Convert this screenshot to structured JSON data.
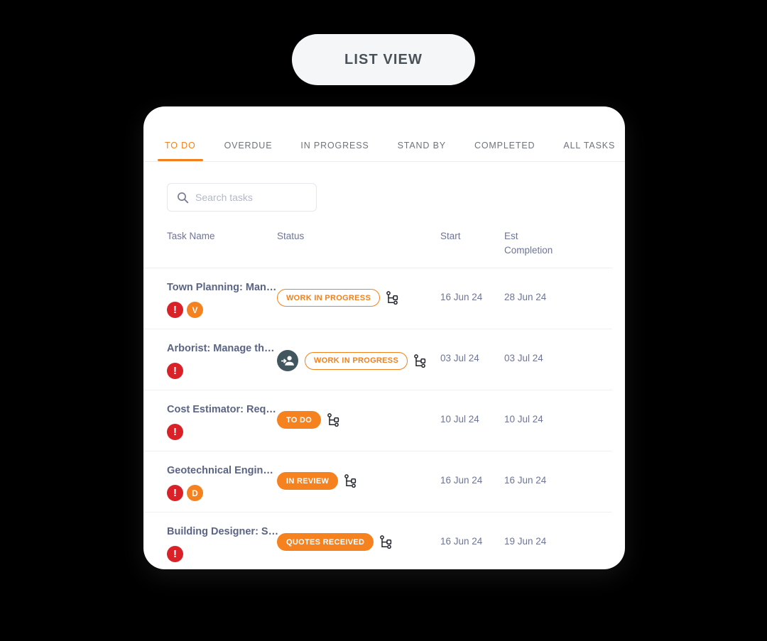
{
  "view_button": {
    "label": "LIST VIEW"
  },
  "tabs": [
    {
      "label": "TO DO",
      "active": true
    },
    {
      "label": "OVERDUE",
      "active": false
    },
    {
      "label": "IN PROGRESS",
      "active": false
    },
    {
      "label": "STAND BY",
      "active": false
    },
    {
      "label": "COMPLETED",
      "active": false
    },
    {
      "label": "ALL TASKS",
      "active": false
    }
  ],
  "search": {
    "value": "",
    "placeholder": "Search tasks",
    "icon": "search-icon"
  },
  "table": {
    "headers": {
      "task_name": "Task Name",
      "status": "Status",
      "start": "Start",
      "est_completion": "Est Completion"
    },
    "rows": [
      {
        "task_name": "Town Planning: Man…",
        "badges": [
          {
            "type": "alert",
            "label": "!",
            "color": "#da2128"
          },
          {
            "type": "letter",
            "label": "V",
            "color": "#f5821f"
          }
        ],
        "avatar": false,
        "status": {
          "label": "WORK IN PROGRESS",
          "style": "outline"
        },
        "branch_icon": "workflow-branch-icon",
        "start": "16 Jun 24",
        "est_completion": "28 Jun 24"
      },
      {
        "task_name": "Arborist: Manage th…",
        "badges": [
          {
            "type": "alert",
            "label": "!",
            "color": "#da2128"
          }
        ],
        "avatar": true,
        "status": {
          "label": "WORK IN PROGRESS",
          "style": "outline"
        },
        "branch_icon": "workflow-branch-icon",
        "start": "03 Jul 24",
        "est_completion": "03 Jul 24"
      },
      {
        "task_name": "Cost Estimator: Req…",
        "badges": [
          {
            "type": "alert",
            "label": "!",
            "color": "#da2128"
          }
        ],
        "avatar": false,
        "status": {
          "label": "TO DO",
          "style": "solid"
        },
        "branch_icon": "workflow-branch-icon",
        "start": "10 Jul 24",
        "est_completion": "10 Jul 24"
      },
      {
        "task_name": "Geotechnical Engin…",
        "badges": [
          {
            "type": "alert",
            "label": "!",
            "color": "#da2128"
          },
          {
            "type": "letter",
            "label": "D",
            "color": "#f5821f"
          }
        ],
        "avatar": false,
        "status": {
          "label": "IN REVIEW",
          "style": "solid"
        },
        "branch_icon": "workflow-branch-icon",
        "start": "16 Jun 24",
        "est_completion": "16 Jun 24"
      },
      {
        "task_name": "Building Designer: S…",
        "badges": [
          {
            "type": "alert",
            "label": "!",
            "color": "#da2128"
          }
        ],
        "avatar": false,
        "status": {
          "label": "QUOTES RECEIVED",
          "style": "solid"
        },
        "branch_icon": "workflow-branch-icon",
        "start": "16 Jun 24",
        "est_completion": "19 Jun 24"
      }
    ]
  },
  "colors": {
    "accent_orange": "#f2811d",
    "alert_red": "#da2128",
    "avatar_slate": "#41565f",
    "text_slate": "#6d7496",
    "title_slate": "#5b6484",
    "background": "#000000",
    "card": "#ffffff"
  }
}
